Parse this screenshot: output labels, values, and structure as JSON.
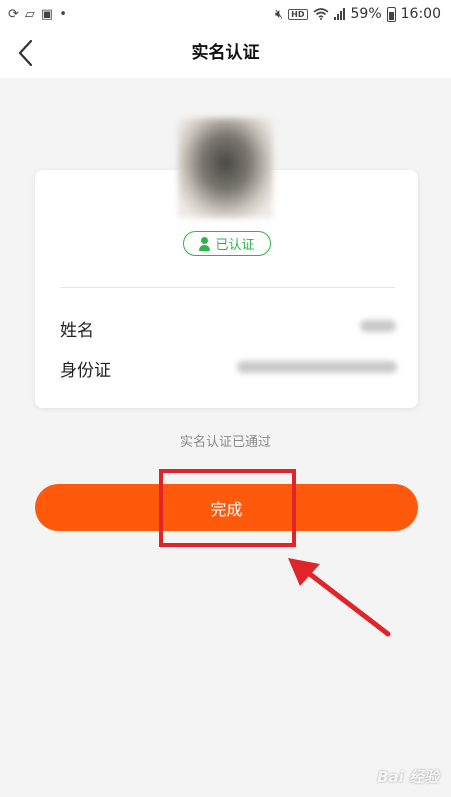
{
  "status_bar": {
    "left_icons": [
      "sync-icon",
      "folder-icon",
      "image-icon",
      "dot-icon"
    ],
    "right_icons": [
      "mute-icon",
      "hd-icon",
      "wifi-icon",
      "signal-icon",
      "battery-icon"
    ],
    "hd_label": "HD",
    "battery_percent": "59%",
    "battery_level": 0.59,
    "time": "16:00"
  },
  "nav": {
    "title": "实名认证",
    "back_icon": "chevron-left-icon"
  },
  "card": {
    "verified_label": "已认证",
    "verified_icon": "person-icon",
    "rows": [
      {
        "label": "姓名"
      },
      {
        "label": "身份证"
      }
    ]
  },
  "status_note": "实名认证已通过",
  "done_button": {
    "label": "完成"
  },
  "colors": {
    "accent": "#ff5a0c",
    "verified": "#2eb54a",
    "annotation": "#e0252a"
  },
  "watermark": "Bai 经验"
}
